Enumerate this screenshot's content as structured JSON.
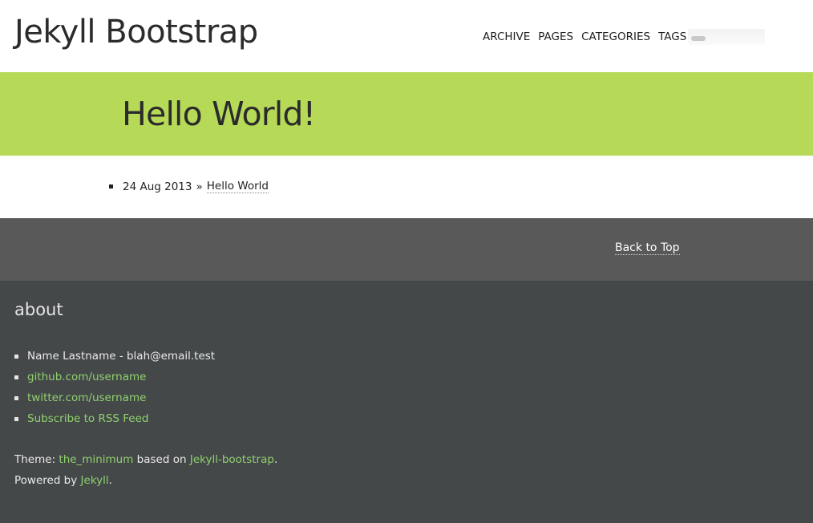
{
  "header": {
    "site_title": "Jekyll Bootstrap",
    "nav": [
      {
        "label": "ARCHIVE"
      },
      {
        "label": "PAGES"
      },
      {
        "label": "CATEGORIES"
      },
      {
        "label": "TAGS"
      }
    ]
  },
  "banner": {
    "title": "Hello World!",
    "background_color": "#b6d957"
  },
  "posts": [
    {
      "date": "24 Aug 2013",
      "separator": "»",
      "title": "Hello World"
    }
  ],
  "back_to_top": {
    "label": "Back to Top"
  },
  "footer": {
    "heading": "about",
    "items": [
      {
        "text": "Name Lastname - blah@email.test",
        "link": false
      },
      {
        "text": "github.com/username",
        "link": true
      },
      {
        "text": "twitter.com/username",
        "link": true
      },
      {
        "text": "Subscribe to RSS Feed",
        "link": true
      }
    ],
    "theme_prefix": "Theme: ",
    "theme_name": "the_minimum",
    "theme_mid": " based on ",
    "theme_base": "Jekyll-bootstrap",
    "theme_suffix": ".",
    "powered_prefix": "Powered by ",
    "powered_name": "Jekyll",
    "powered_suffix": ".",
    "link_color": "#8fd16e",
    "background_color": "#444849"
  }
}
